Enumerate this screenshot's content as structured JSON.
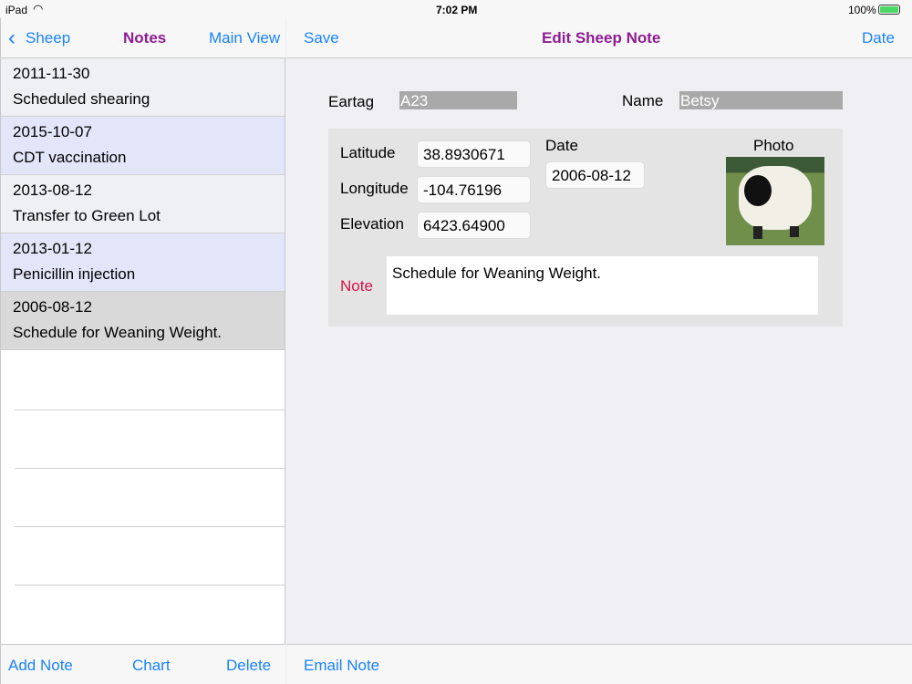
{
  "status": {
    "device": "iPad",
    "time": "7:02 PM",
    "battery": "100%"
  },
  "master": {
    "back_label": "Sheep",
    "title": "Notes",
    "main_view_label": "Main View",
    "notes": [
      {
        "date": "2011-11-30",
        "text": "Scheduled shearing"
      },
      {
        "date": "2015-10-07",
        "text": "CDT vaccination"
      },
      {
        "date": "2013-08-12",
        "text": "Transfer to Green Lot"
      },
      {
        "date": "2013-01-12",
        "text": "Penicillin injection"
      },
      {
        "date": "2006-08-12",
        "text": "Schedule for Weaning Weight."
      }
    ],
    "toolbar": {
      "add": "Add Note",
      "chart": "Chart",
      "delete": "Delete"
    }
  },
  "detail": {
    "save_label": "Save",
    "title": "Edit Sheep Note",
    "date_label": "Date",
    "eartag_label": "Eartag",
    "eartag": "A23",
    "name_label": "Name",
    "name": "Betsy",
    "latitude_label": "Latitude",
    "latitude": "38.8930671",
    "longitude_label": "Longitude",
    "longitude": "-104.76196",
    "elevation_label": "Elevation",
    "elevation": "6423.64900",
    "note_date_label": "Date",
    "note_date": "2006-08-12",
    "photo_label": "Photo",
    "note_label": "Note",
    "note": "Schedule for Weaning Weight.",
    "email_label": "Email Note"
  }
}
